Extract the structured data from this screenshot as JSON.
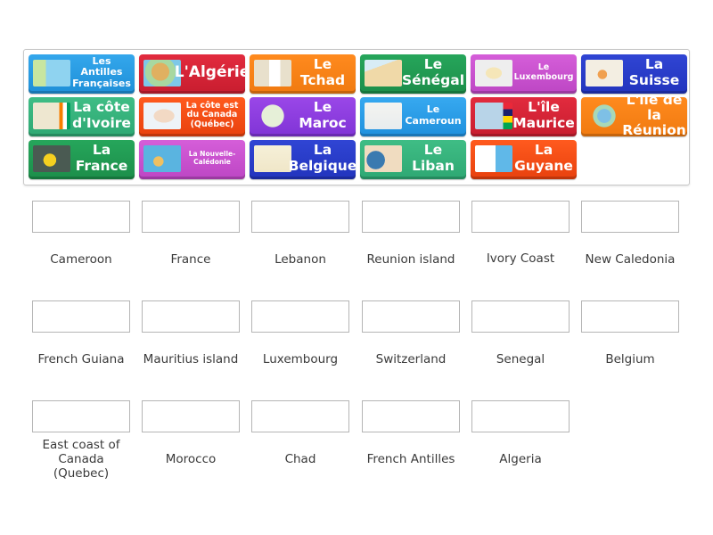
{
  "tiles": [
    {
      "text": "Les Antilles Françaises",
      "color": "#1e8fd8",
      "thumb": "map-caribbean"
    },
    {
      "text": "L'Algérie",
      "color": "#c81d2f",
      "thumb": "map-africa"
    },
    {
      "text": "Le Tchad",
      "color": "#f07a10",
      "thumb": "map-chad"
    },
    {
      "text": "Le Sénégal",
      "color": "#1c8e4a",
      "thumb": "map-senegal"
    },
    {
      "text": "Le Luxembourg",
      "color": "#bd46c4",
      "thumb": "map-luxembourg"
    },
    {
      "text": "La Suisse",
      "color": "#2234bd",
      "thumb": "map-switzerland"
    },
    {
      "text": "La côte d'Ivoire",
      "color": "#2ea873",
      "thumb": "map-ivory-coast"
    },
    {
      "text": "La côte est du Canada (Québec)",
      "color": "#e8410e",
      "thumb": "map-quebec"
    },
    {
      "text": "Le Maroc",
      "color": "#8034d6",
      "thumb": "globe-morocco"
    },
    {
      "text": "Le Cameroun",
      "color": "#1f90dd",
      "thumb": "map-cameroon"
    },
    {
      "text": "L'île Maurice",
      "color": "#c81d2f",
      "thumb": "map-mauritius"
    },
    {
      "text": "L'île de la Réunion",
      "color": "#f07a10",
      "thumb": "globe-reunion"
    },
    {
      "text": "La France",
      "color": "#1c8e4a",
      "thumb": "map-france"
    },
    {
      "text": "La Nouvelle-Calédonie",
      "color": "#bd46c4",
      "thumb": "map-new-caledonia"
    },
    {
      "text": "La Belgique",
      "color": "#2234bd",
      "thumb": "map-belgium"
    },
    {
      "text": "Le Liban",
      "color": "#2ea873",
      "thumb": "globe-lebanon"
    },
    {
      "text": "La Guyane",
      "color": "#e8410e",
      "thumb": "map-guiana"
    }
  ],
  "targets": [
    "Cameroon",
    "France",
    "Lebanon",
    "Reunion island",
    "Ivory Coast",
    "New Caledonia",
    "French Guiana",
    "Mauritius island",
    "Luxembourg",
    "Switzerland",
    "Senegal",
    "Belgium",
    "East coast of Canada (Quebec)",
    "Morocco",
    "Chad",
    "French Antilles",
    "Algeria"
  ]
}
